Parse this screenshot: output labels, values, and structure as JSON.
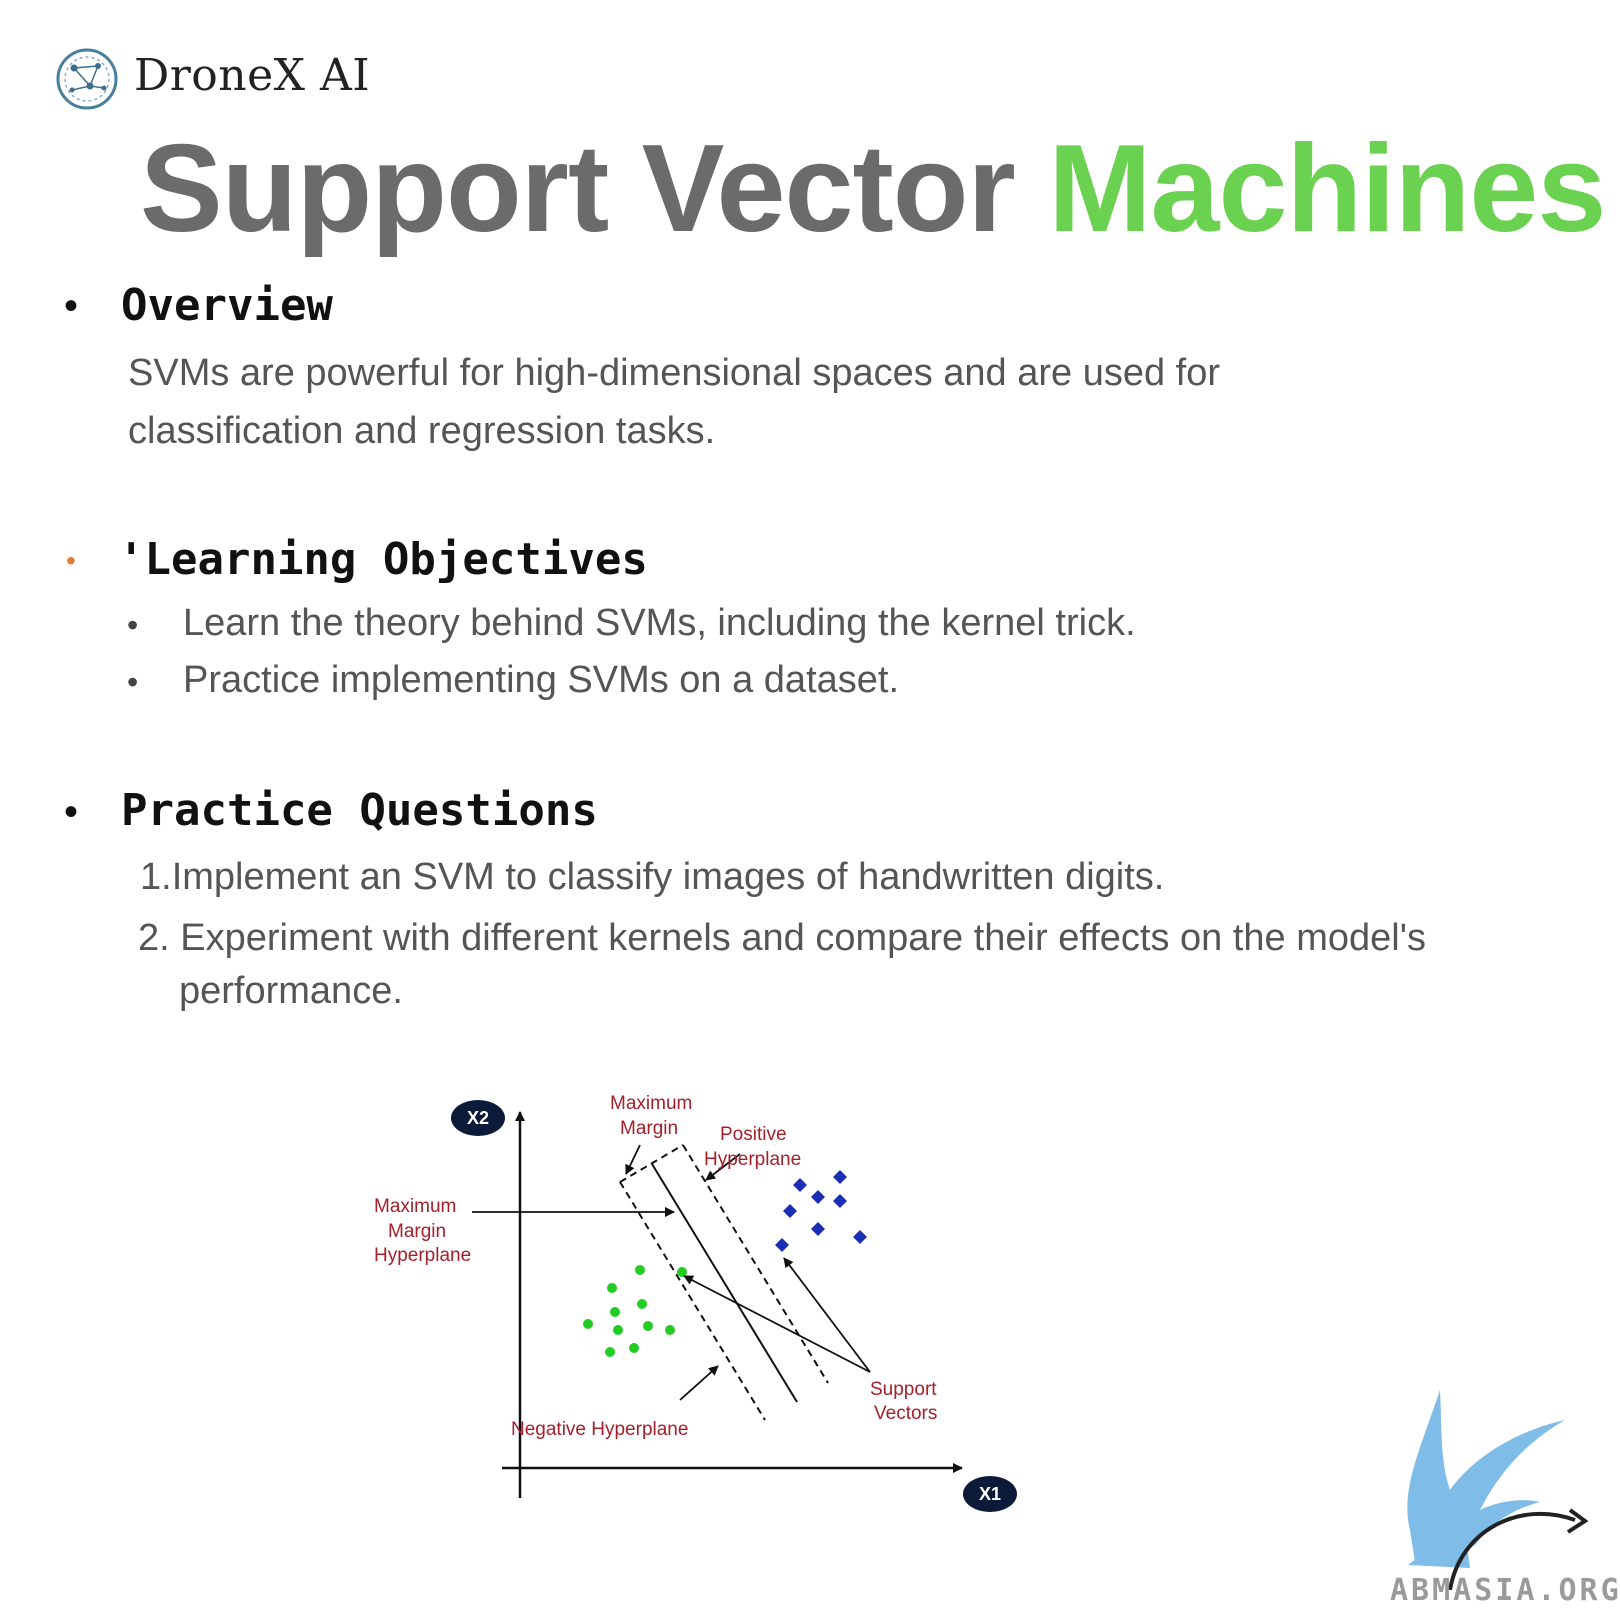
{
  "header": {
    "brand": "DroneX AI",
    "title_main": "Support Vector ",
    "title_highlight": "Machines"
  },
  "overview": {
    "bullet": "•",
    "heading": "Overview",
    "text_line1": "SVMs are powerful for high-dimensional spaces and are used for",
    "text_line2": "classification and regression tasks."
  },
  "objectives": {
    "bullet": "•",
    "bullet_color": "#e07a3a",
    "heading": "'Learning Objectives",
    "items": [
      "Learn the theory behind SVMs, including the kernel trick.",
      "Practice implementing SVMs on a dataset."
    ],
    "sub_bullet": "•"
  },
  "practice": {
    "bullet": "•",
    "heading": "Practice Questions",
    "q1": "1.Implement an SVM to classify images of handwritten digits.",
    "q2_line1": "2. Experiment with different kernels and compare their effects on the model's",
    "q2_line2": "performance."
  },
  "figure": {
    "x2_label": "X2",
    "x1_label": "X1",
    "max_margin_top_1": "Maximum",
    "max_margin_top_2": "Margin",
    "positive_1": "Positive",
    "positive_2": "Hyperplane",
    "mmh_1": "Maximum",
    "mmh_2": "Margin",
    "mmh_3": "Hyperplane",
    "negative": "Negative Hyperplane",
    "support_1": "Support",
    "support_2": "Vectors",
    "green_color": "#22cc22",
    "blue_color": "#1a2fb5",
    "label_color": "#a5202b"
  },
  "watermark": {
    "text": "ABMASIA.ORG",
    "griffin_color": "#7fbde8"
  }
}
